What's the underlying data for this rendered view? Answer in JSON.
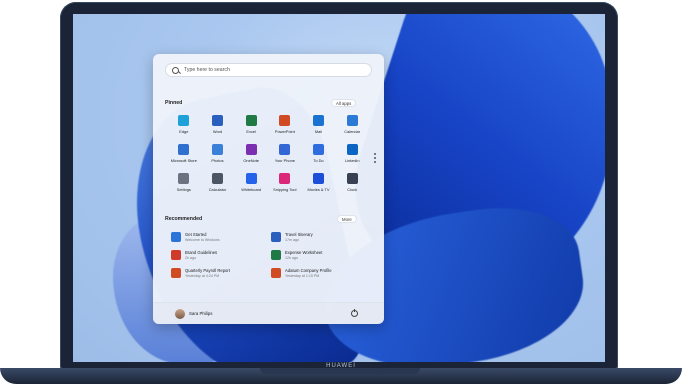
{
  "device": {
    "brand": "HUAWEI"
  },
  "start_menu": {
    "search": {
      "placeholder": "Type here to search"
    },
    "pinned": {
      "title": "Pinned",
      "all_apps": "All apps",
      "apps": [
        {
          "label": "Edge",
          "icon": "edge-icon",
          "color": "#1ea1d8"
        },
        {
          "label": "Word",
          "icon": "word-icon",
          "color": "#2b5fbd"
        },
        {
          "label": "Excel",
          "icon": "excel-icon",
          "color": "#1f7a45"
        },
        {
          "label": "PowerPoint",
          "icon": "powerpoint-icon",
          "color": "#d04a23"
        },
        {
          "label": "Mail",
          "icon": "mail-icon",
          "color": "#1b73d1"
        },
        {
          "label": "Calendar",
          "icon": "calendar-icon",
          "color": "#2a7ad6"
        },
        {
          "label": "Microsoft Store",
          "icon": "store-icon",
          "color": "#2e6fd0"
        },
        {
          "label": "Photos",
          "icon": "photos-icon",
          "color": "#3a7fd8"
        },
        {
          "label": "OneNote",
          "icon": "onenote-icon",
          "color": "#7b2fb0"
        },
        {
          "label": "Your Phone",
          "icon": "phone-icon",
          "color": "#3467d6"
        },
        {
          "label": "To Do",
          "icon": "todo-icon",
          "color": "#2f6ce0"
        },
        {
          "label": "LinkedIn",
          "icon": "linkedin-icon",
          "color": "#0a66c2"
        },
        {
          "label": "Settings",
          "icon": "settings-icon",
          "color": "#6b7280"
        },
        {
          "label": "Calculator",
          "icon": "calculator-icon",
          "color": "#4b5563"
        },
        {
          "label": "Whiteboard",
          "icon": "whiteboard-icon",
          "color": "#2563eb"
        },
        {
          "label": "Snipping Tool",
          "icon": "snipping-tool-icon",
          "color": "#db2777"
        },
        {
          "label": "Movies & TV",
          "icon": "movies-icon",
          "color": "#1d4ed8"
        },
        {
          "label": "Clock",
          "icon": "clock-icon",
          "color": "#374151"
        }
      ]
    },
    "recommended": {
      "title": "Recommended",
      "more": "More",
      "items": [
        {
          "title": "Get Started",
          "sub": "Welcome to Windows",
          "icon": "get-started-icon",
          "color": "#2b74d8"
        },
        {
          "title": "Travel Itinerary",
          "sub": "17m ago",
          "icon": "word-doc-icon",
          "color": "#2b5fbd"
        },
        {
          "title": "Brand Guidelines",
          "sub": "2h ago",
          "icon": "pdf-icon",
          "color": "#d03a2b"
        },
        {
          "title": "Expense Worksheet",
          "sub": "12h ago",
          "icon": "excel-doc-icon",
          "color": "#1f7a45"
        },
        {
          "title": "Quarterly Payroll Report",
          "sub": "Yesterday at 4:24 PM",
          "icon": "powerpoint-doc-icon",
          "color": "#d04a23"
        },
        {
          "title": "Adatum Company Profile",
          "sub": "Yesterday at 1:15 PM",
          "icon": "powerpoint-doc-icon",
          "color": "#d04a23"
        }
      ]
    },
    "user": {
      "name": "Sara Philips"
    }
  }
}
